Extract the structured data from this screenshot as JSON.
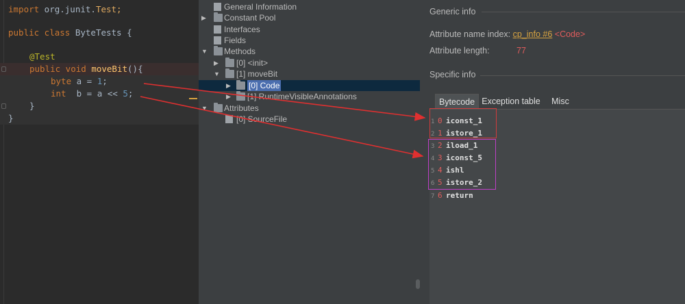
{
  "editor": {
    "import_kw": "import",
    "import_pkg": " org.junit.",
    "import_cls": "Test;",
    "class_mod": "public class",
    "class_name": " ByteTests {",
    "annotation": "@Test",
    "method_mod": "public void",
    "method_name": " moveBit",
    "method_tail": "(){",
    "line_byte_kw": "byte",
    "line_byte_rest": " a = ",
    "line_byte_num": "1",
    "line_byte_end": ";",
    "line_int_kw": "int",
    "line_int_rest": "  b = a << ",
    "line_int_num": "5",
    "line_int_end": ";",
    "close_method": "}",
    "close_class": "}"
  },
  "tree": {
    "nodes": [
      {
        "label": "General Information"
      },
      {
        "label": "Constant Pool"
      },
      {
        "label": "Interfaces"
      },
      {
        "label": "Fields"
      },
      {
        "label": "Methods"
      },
      {
        "label": "[0] <init>"
      },
      {
        "label": "[1] moveBit"
      },
      {
        "label": "[0] Code"
      },
      {
        "label": "[1] RuntimeVisibleAnnotations"
      },
      {
        "label": "Attributes"
      },
      {
        "label": "[0] SourceFile"
      }
    ],
    "arrow_collapsed": "▶",
    "arrow_expanded": "▼"
  },
  "info": {
    "generic_title": "Generic info",
    "attr_name_label": "Attribute name index:",
    "attr_name_link": "cp_info #6",
    "attr_name_ref": "<Code>",
    "attr_len_label": "Attribute length:",
    "attr_len_value": "77",
    "specific_title": "Specific info",
    "tabs": [
      "Bytecode",
      "Exception table",
      "Misc"
    ]
  },
  "bytecode": [
    {
      "ln": "1",
      "off": "0",
      "op": "iconst_1"
    },
    {
      "ln": "2",
      "off": "1",
      "op": "istore_1"
    },
    {
      "ln": "3",
      "off": "2",
      "op": "iload_1"
    },
    {
      "ln": "4",
      "off": "3",
      "op": "iconst_5"
    },
    {
      "ln": "5",
      "off": "4",
      "op": "ishl"
    },
    {
      "ln": "6",
      "off": "5",
      "op": "istore_2"
    },
    {
      "ln": "7",
      "off": "6",
      "op": "return"
    }
  ],
  "colors": {
    "arrow": "#e03030",
    "box_red": "#d03c3c",
    "box_magenta": "#c040c8"
  }
}
